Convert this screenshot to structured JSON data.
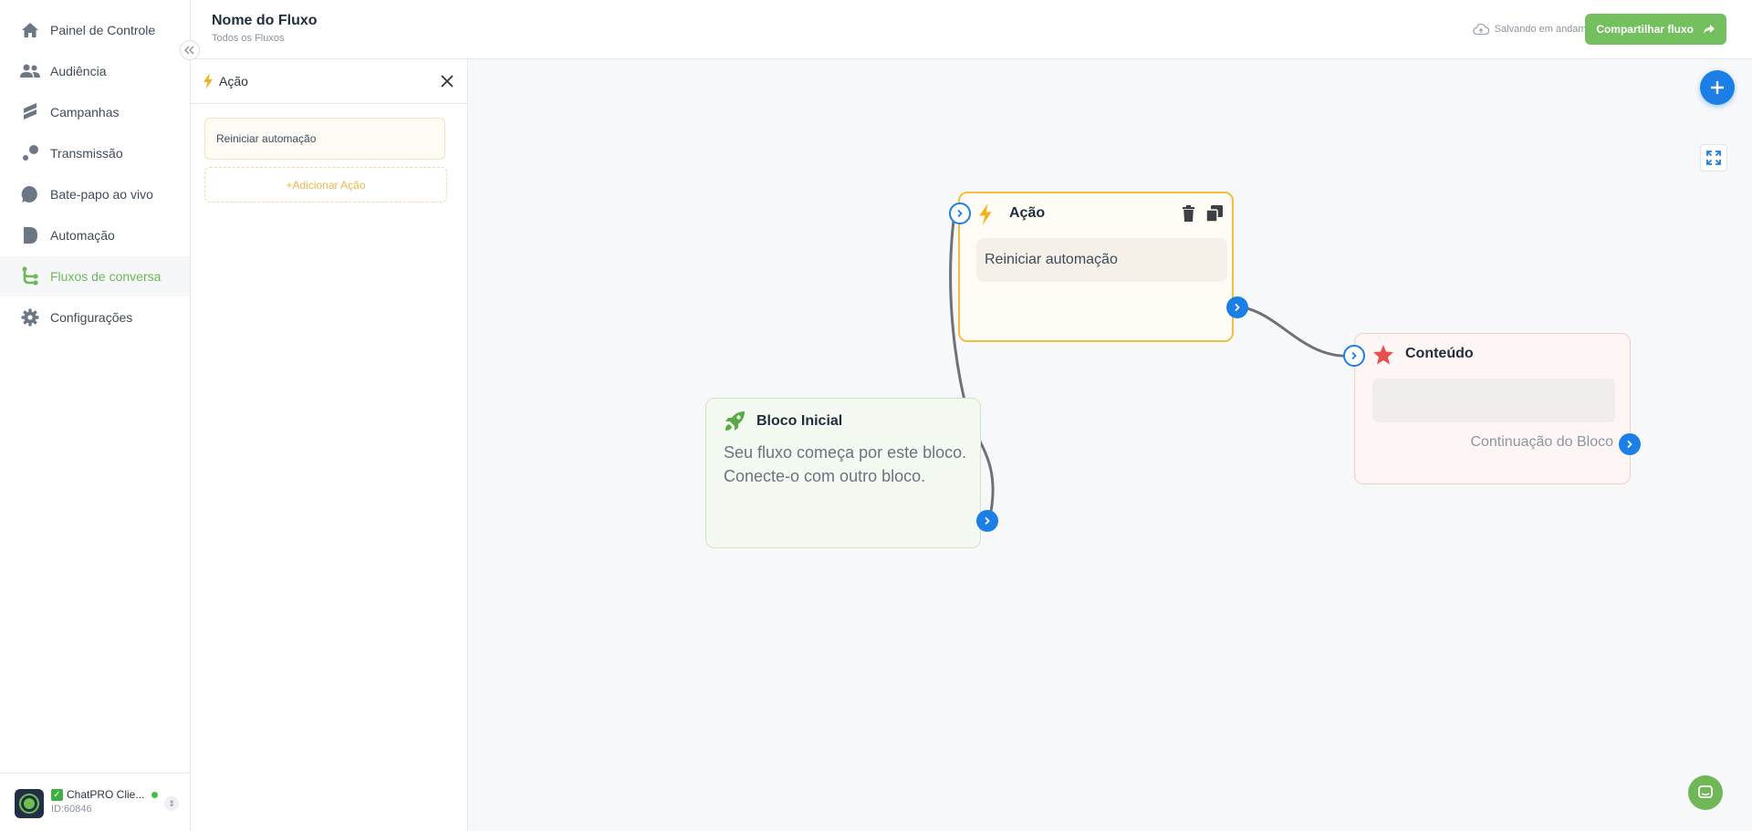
{
  "sidebar": {
    "items": [
      {
        "label": "Painel de Controle",
        "icon": "home-icon",
        "active": false
      },
      {
        "label": "Audiência",
        "icon": "users-icon",
        "active": false
      },
      {
        "label": "Campanhas",
        "icon": "campaigns-icon",
        "active": false
      },
      {
        "label": "Transmissão",
        "icon": "broadcast-icon",
        "active": false
      },
      {
        "label": "Bate-papo ao vivo",
        "icon": "chat-bubble-icon",
        "active": false
      },
      {
        "label": "Automação",
        "icon": "automation-icon",
        "active": false
      },
      {
        "label": "Fluxos de conversa",
        "icon": "flow-icon",
        "active": true
      },
      {
        "label": "Configurações",
        "icon": "gear-icon",
        "active": false
      }
    ],
    "collapse_icon": "double-chevron-left-icon",
    "profile": {
      "name": "ChatPRO Clie...",
      "id": "ID:60846",
      "status": "online"
    }
  },
  "header": {
    "title": "Nome do Fluxo",
    "subtitle": "Todos os Fluxos",
    "saving_status": "Salvando em andamento",
    "share_label": "Compartilhar fluxo"
  },
  "panel": {
    "title": "Ação",
    "actions": [
      "Reiniciar automação"
    ],
    "add_action_label": "+Adicionar Ação"
  },
  "canvas": {
    "nodes": {
      "start": {
        "title": "Bloco Inicial",
        "description_line1": "Seu fluxo começa por este bloco.",
        "description_line2": "Conecte-o com outro bloco."
      },
      "action": {
        "title": "Ação",
        "item": "Reiniciar automação"
      },
      "content": {
        "title": "Conteúdo",
        "continuation": "Continuação do Bloco"
      }
    }
  },
  "colors": {
    "accent_green": "#6fb757",
    "primary_blue": "#1c7fe6",
    "action_border": "#f0c040",
    "content_star": "#e8504e"
  }
}
